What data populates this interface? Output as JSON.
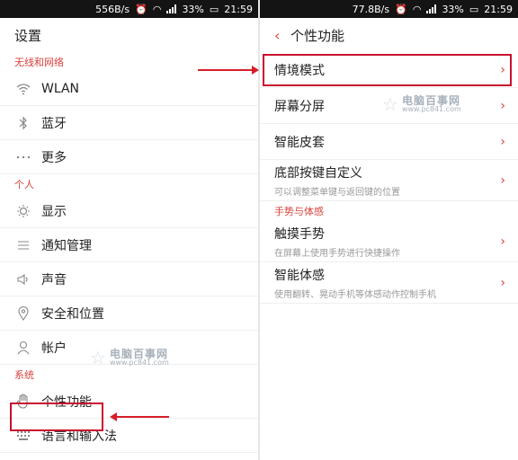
{
  "left": {
    "status": {
      "speed": "556B/s",
      "battery": "33%",
      "time": "21:59"
    },
    "title": "设置",
    "sections": [
      {
        "label": "无线和网络",
        "items": [
          {
            "icon": "wifi-icon",
            "label": "WLAN"
          },
          {
            "icon": "bluetooth-icon",
            "label": "蓝牙"
          },
          {
            "icon": "more-icon",
            "label": "更多"
          }
        ]
      },
      {
        "label": "个人",
        "items": [
          {
            "icon": "brightness-icon",
            "label": "显示"
          },
          {
            "icon": "notification-list-icon",
            "label": "通知管理"
          },
          {
            "icon": "speaker-icon",
            "label": "声音"
          },
          {
            "icon": "location-icon",
            "label": "安全和位置"
          },
          {
            "icon": "account-icon",
            "label": "帐户"
          }
        ]
      },
      {
        "label": "系统",
        "items": [
          {
            "icon": "hand-icon",
            "label": "个性功能"
          },
          {
            "icon": "keyboard-icon",
            "label": "语言和输入法"
          }
        ]
      }
    ],
    "watermark": {
      "name": "电脑百事网",
      "url": "www.pc841.com"
    }
  },
  "right": {
    "status": {
      "speed": "77.8B/s",
      "battery": "33%",
      "time": "21:59"
    },
    "title": "个性功能",
    "items": [
      {
        "label": "情境模式",
        "sub": ""
      },
      {
        "label": "屏幕分屏",
        "sub": ""
      },
      {
        "label": "智能皮套",
        "sub": ""
      },
      {
        "label": "底部按键自定义",
        "sub": "可以调整菜单键与返回键的位置"
      }
    ],
    "section": {
      "label": "手势与体感",
      "items": [
        {
          "label": "触摸手势",
          "sub": "在屏幕上使用手势进行快捷操作"
        },
        {
          "label": "智能体感",
          "sub": "使用翻转、晃动手机等体感动作控制手机"
        }
      ]
    },
    "watermark": {
      "name": "电脑百事网",
      "url": "www.pc841.com"
    }
  },
  "colors": {
    "accent": "#d9413a",
    "annotation": "#c8102e"
  }
}
